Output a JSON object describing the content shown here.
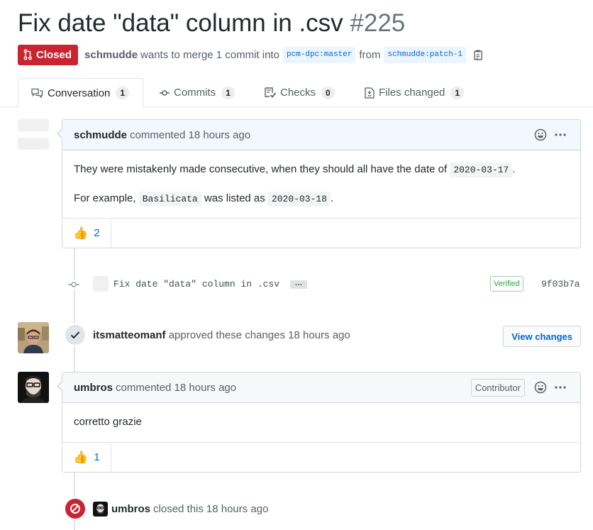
{
  "pr": {
    "title": "Fix date \"data\" column in .csv",
    "number": "#225",
    "state": "Closed",
    "author": "schmudde",
    "merge_text": "wants to merge 1 commit into",
    "base_branch": "pcm-dpc:master",
    "from_text": "from",
    "head_branch": "schmudde:patch-1"
  },
  "tabs": [
    {
      "label": "Conversation",
      "count": "1",
      "icon": "comment-discussion-icon"
    },
    {
      "label": "Commits",
      "count": "1",
      "icon": "git-commit-icon"
    },
    {
      "label": "Checks",
      "count": "0",
      "icon": "checklist-icon"
    },
    {
      "label": "Files changed",
      "count": "1",
      "icon": "file-diff-icon"
    }
  ],
  "comment1": {
    "author": "schmudde",
    "action": "commented 18 hours ago",
    "p1_text": "They were mistakenly made consecutive, when they should all have the date of",
    "p1_code": "2020-03-17",
    "p1_end": ".",
    "p2_prefix": "For example,",
    "p2_code1": "Basilicata",
    "p2_mid": "was listed as",
    "p2_code2": "2020-03-18",
    "p2_end": ".",
    "reaction_emoji": "👍",
    "reaction_count": "2"
  },
  "commit": {
    "message": "Fix date \"data\" column in .csv",
    "ellipsis": "…",
    "verified": "Verified",
    "sha": "9f03b7a"
  },
  "review": {
    "author": "itsmatteomanf",
    "action": "approved these changes",
    "time": "18 hours ago",
    "button": "View changes"
  },
  "comment2": {
    "author": "umbros",
    "action": "commented 18 hours ago",
    "role": "Contributor",
    "body": "corretto grazie",
    "reaction_emoji": "👍",
    "reaction_count": "1"
  },
  "closed_event": {
    "author": "umbros",
    "text": "closed this",
    "time": "18 hours ago"
  },
  "colors": {
    "closed_red": "#cb2431",
    "link_blue": "#0366d6",
    "verified_green": "#28a745"
  }
}
